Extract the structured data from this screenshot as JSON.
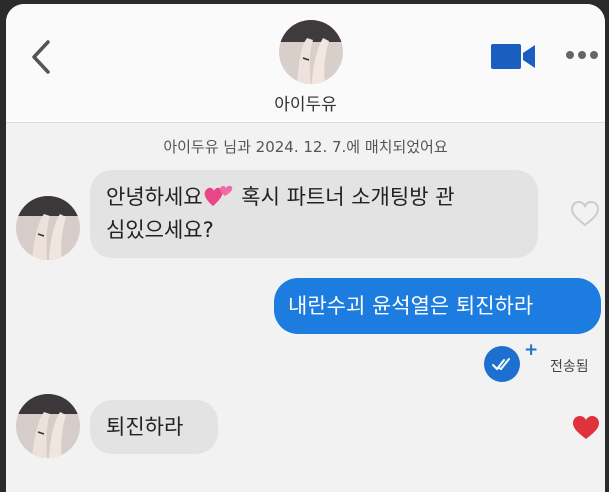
{
  "header": {
    "name": "아이두유",
    "back_icon": "chevron-left-icon",
    "video_icon": "video-call-icon",
    "more_icon": "more-dots-icon"
  },
  "match_notice": "아이두유 님과 2024. 12. 7.에 매치되었어요",
  "messages": [
    {
      "sender": "them",
      "line1_before": "안녕하세요",
      "emoji": "two-hearts-emoji",
      "line1_after": " 혹시 파트너 소개팅방 관",
      "line2": "심있으세요?",
      "liked": false
    },
    {
      "sender": "me",
      "text": "내란수괴 윤석열은 퇴진하라"
    },
    {
      "sender": "them",
      "text": "퇴진하라",
      "liked": true
    }
  ],
  "status": {
    "plus": "+",
    "sent_label": "전송됨"
  },
  "colors": {
    "accent": "#1d7ce0",
    "heart_red": "#e0323a",
    "bubble_gray": "#e3e3e3"
  }
}
